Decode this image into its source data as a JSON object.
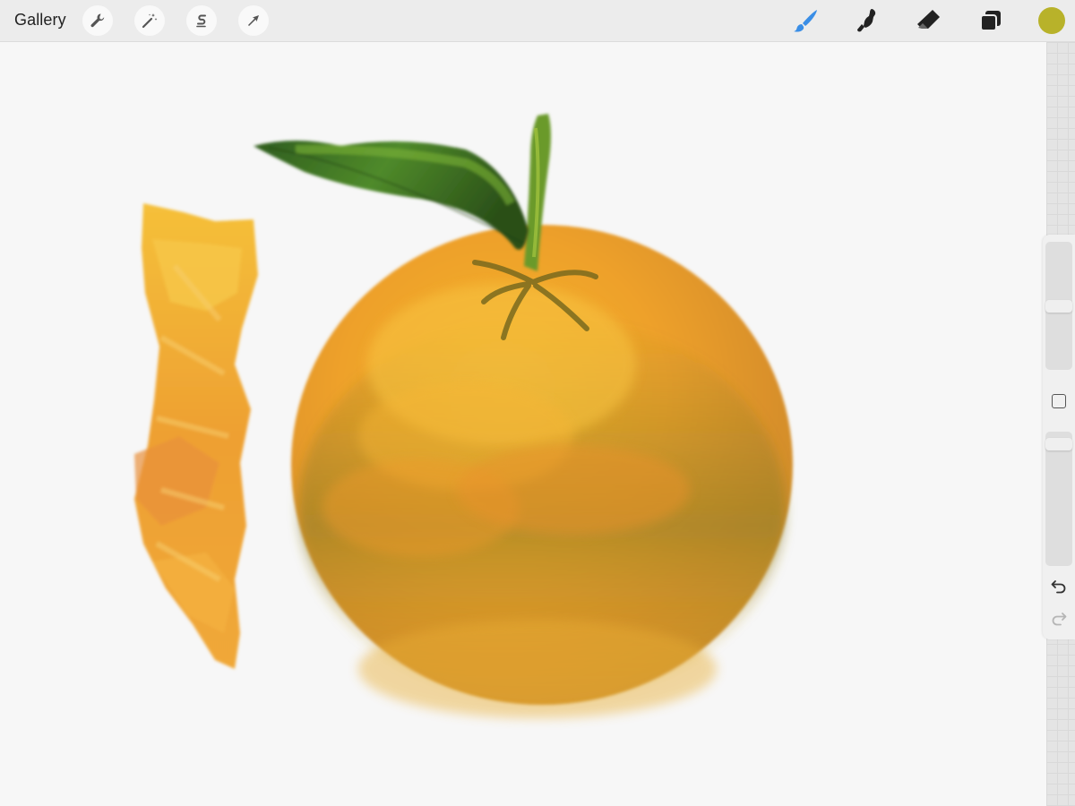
{
  "app": {
    "gallery_label": "Gallery"
  },
  "toolbar": {
    "left_tools": [
      {
        "name": "actions-wrench-icon"
      },
      {
        "name": "adjustments-magic-wand-icon"
      },
      {
        "name": "selection-s-icon"
      },
      {
        "name": "transform-arrow-icon"
      }
    ],
    "right_tools": [
      {
        "name": "brush-icon",
        "active": true
      },
      {
        "name": "smudge-icon",
        "active": false
      },
      {
        "name": "eraser-icon",
        "active": false
      },
      {
        "name": "layers-icon",
        "active": false
      }
    ],
    "current_color": "#b8b22a",
    "active_tool_color": "#3a8ee6"
  },
  "sidebar": {
    "brush_size": 0.5,
    "brush_opacity": 0.95,
    "controls": [
      "modify-button",
      "undo-button",
      "redo-button"
    ]
  }
}
